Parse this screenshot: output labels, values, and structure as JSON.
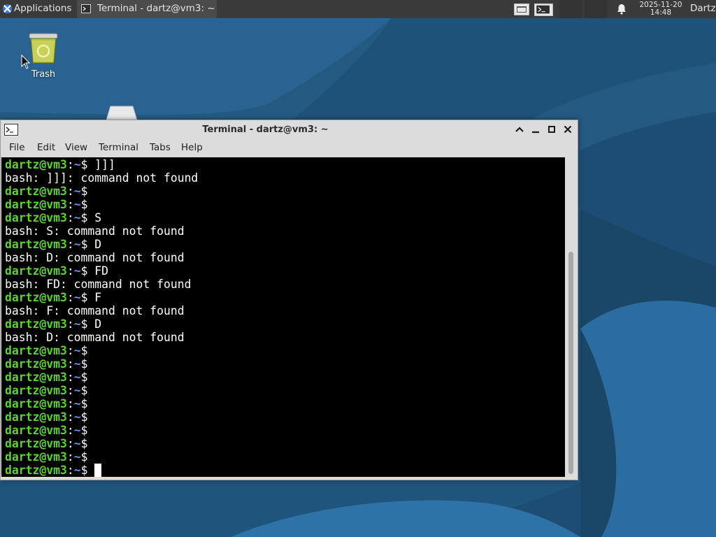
{
  "colors": {
    "panel_bg": "#3a3a3a",
    "wallpaper": "#1b4a6e",
    "prompt_green": "#5fd234",
    "terminal_bg": "#000000",
    "window_chrome": "#dcdcdc"
  },
  "panel": {
    "applications_label": "Applications",
    "applications_icon": "xfce-logo-icon",
    "task_label": "Terminal - dartz@vm3: ~",
    "task_icon": "terminal-icon",
    "clock_date": "2025-11-20",
    "clock_time": "14:48",
    "user_label": "Dartz",
    "notification_icon": "bell-icon"
  },
  "desktop": {
    "trash_label": "Trash",
    "trash_icon": "trash-icon"
  },
  "window": {
    "title": "Terminal - dartz@vm3: ~",
    "menu": [
      "File",
      "Edit",
      "View",
      "Terminal",
      "Tabs",
      "Help"
    ]
  },
  "terminal": {
    "prompt_user": "dartz@vm3",
    "prompt_sep": ":",
    "prompt_dir": "~",
    "prompt_symbol": "$",
    "lines": [
      {
        "type": "prompt",
        "cmd": " ]]]"
      },
      {
        "type": "output",
        "text": "bash: ]]]: command not found"
      },
      {
        "type": "prompt",
        "cmd": ""
      },
      {
        "type": "prompt",
        "cmd": ""
      },
      {
        "type": "prompt",
        "cmd": " S"
      },
      {
        "type": "output",
        "text": "bash: S: command not found"
      },
      {
        "type": "prompt",
        "cmd": " D"
      },
      {
        "type": "output",
        "text": "bash: D: command not found"
      },
      {
        "type": "prompt",
        "cmd": " FD"
      },
      {
        "type": "output",
        "text": "bash: FD: command not found"
      },
      {
        "type": "prompt",
        "cmd": " F"
      },
      {
        "type": "output",
        "text": "bash: F: command not found"
      },
      {
        "type": "prompt",
        "cmd": " D"
      },
      {
        "type": "output",
        "text": "bash: D: command not found"
      },
      {
        "type": "prompt",
        "cmd": ""
      },
      {
        "type": "prompt",
        "cmd": ""
      },
      {
        "type": "prompt",
        "cmd": ""
      },
      {
        "type": "prompt",
        "cmd": ""
      },
      {
        "type": "prompt",
        "cmd": ""
      },
      {
        "type": "prompt",
        "cmd": ""
      },
      {
        "type": "prompt",
        "cmd": ""
      },
      {
        "type": "prompt",
        "cmd": ""
      },
      {
        "type": "prompt",
        "cmd": ""
      },
      {
        "type": "prompt",
        "cmd": " ",
        "cursor": true
      }
    ]
  }
}
